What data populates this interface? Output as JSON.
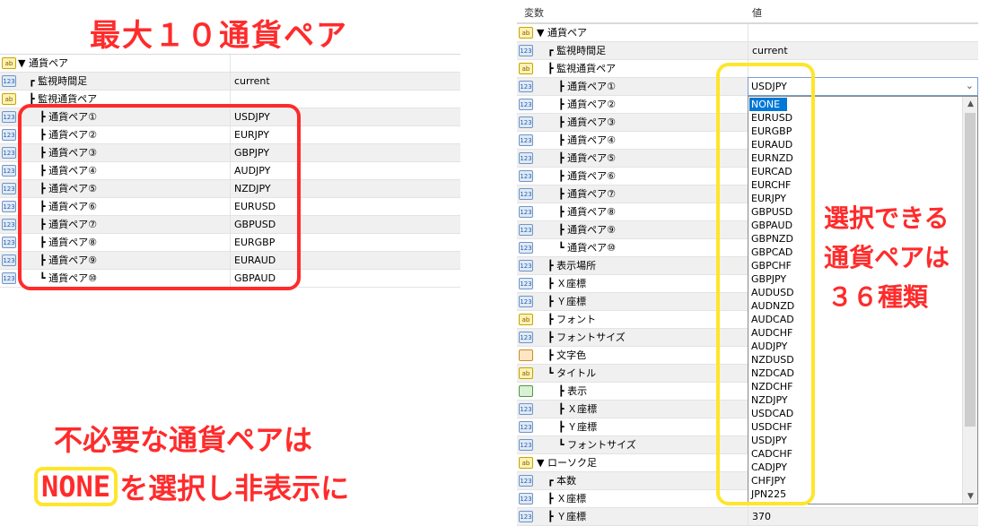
{
  "title": "最大１０通貨ペア",
  "note_unneeded_line1": "不必要な通貨ペアは",
  "note_none": "NONE",
  "note_unneeded_line2": "を選択し非表示に",
  "note_select_lines": [
    "選択できる",
    "通貨ペアは",
    "３６種類"
  ],
  "icons": {
    "num": "123",
    "ab": "ab"
  },
  "left_grid": {
    "rows": [
      {
        "icon": "ab",
        "name": "▼ 通貨ペア",
        "value": "",
        "indent": 0
      },
      {
        "icon": "num",
        "name": "┏ 監視時間足",
        "value": "current",
        "indent": 1
      },
      {
        "icon": "ab",
        "name": "┣ 監視通貨ペア",
        "value": "",
        "indent": 1
      },
      {
        "icon": "num",
        "name": "┣ 通貨ペア①",
        "value": "USDJPY",
        "indent": 2
      },
      {
        "icon": "num",
        "name": "┣ 通貨ペア②",
        "value": "EURJPY",
        "indent": 2
      },
      {
        "icon": "num",
        "name": "┣ 通貨ペア③",
        "value": "GBPJPY",
        "indent": 2
      },
      {
        "icon": "num",
        "name": "┣ 通貨ペア④",
        "value": "AUDJPY",
        "indent": 2
      },
      {
        "icon": "num",
        "name": "┣ 通貨ペア⑤",
        "value": "NZDJPY",
        "indent": 2
      },
      {
        "icon": "num",
        "name": "┣ 通貨ペア⑥",
        "value": "EURUSD",
        "indent": 2
      },
      {
        "icon": "num",
        "name": "┣ 通貨ペア⑦",
        "value": "GBPUSD",
        "indent": 2
      },
      {
        "icon": "num",
        "name": "┣ 通貨ペア⑧",
        "value": "EURGBP",
        "indent": 2
      },
      {
        "icon": "num",
        "name": "┣ 通貨ペア⑨",
        "value": "EURAUD",
        "indent": 2
      },
      {
        "icon": "num",
        "name": "┗ 通貨ペア⑩",
        "value": "GBPAUD",
        "indent": 2
      }
    ]
  },
  "right_grid": {
    "header_var": "変数",
    "header_val": "値",
    "rows": [
      {
        "icon": "ab",
        "name": "▼ 通貨ペア",
        "value": "",
        "indent": 0
      },
      {
        "icon": "num",
        "name": "┏ 監視時間足",
        "value": "current",
        "indent": 1
      },
      {
        "icon": "ab",
        "name": "┣ 監視通貨ペア",
        "value": "",
        "indent": 1
      },
      {
        "icon": "num",
        "name": "┣ 通貨ペア①",
        "value": "",
        "indent": 2
      },
      {
        "icon": "num",
        "name": "┣ 通貨ペア②",
        "value": "",
        "indent": 2
      },
      {
        "icon": "num",
        "name": "┣ 通貨ペア③",
        "value": "",
        "indent": 2
      },
      {
        "icon": "num",
        "name": "┣ 通貨ペア④",
        "value": "",
        "indent": 2
      },
      {
        "icon": "num",
        "name": "┣ 通貨ペア⑤",
        "value": "",
        "indent": 2
      },
      {
        "icon": "num",
        "name": "┣ 通貨ペア⑥",
        "value": "",
        "indent": 2
      },
      {
        "icon": "num",
        "name": "┣ 通貨ペア⑦",
        "value": "",
        "indent": 2
      },
      {
        "icon": "num",
        "name": "┣ 通貨ペア⑧",
        "value": "",
        "indent": 2
      },
      {
        "icon": "num",
        "name": "┣ 通貨ペア⑨",
        "value": "",
        "indent": 2
      },
      {
        "icon": "num",
        "name": "┗ 通貨ペア⑩",
        "value": "",
        "indent": 2
      },
      {
        "icon": "num",
        "name": "┣ 表示場所",
        "value": "",
        "indent": 1
      },
      {
        "icon": "num",
        "name": "┣ Ｘ座標",
        "value": "",
        "indent": 1
      },
      {
        "icon": "num",
        "name": "┣ Ｙ座標",
        "value": "",
        "indent": 1
      },
      {
        "icon": "ab",
        "name": "┣ フォント",
        "value": "",
        "indent": 1
      },
      {
        "icon": "num",
        "name": "┣ フォントサイズ",
        "value": "",
        "indent": 1
      },
      {
        "icon": "color",
        "name": "┣ 文字色",
        "value": "",
        "indent": 1
      },
      {
        "icon": "ab",
        "name": "┗ タイトル",
        "value": "",
        "indent": 1
      },
      {
        "icon": "bool",
        "name": "┣ 表示",
        "value": "",
        "indent": 2
      },
      {
        "icon": "num",
        "name": "┣ Ｘ座標",
        "value": "",
        "indent": 2
      },
      {
        "icon": "num",
        "name": "┣ Ｙ座標",
        "value": "",
        "indent": 2
      },
      {
        "icon": "num",
        "name": "┗ フォントサイズ",
        "value": "",
        "indent": 2
      },
      {
        "icon": "ab",
        "name": "▼ ローソク足",
        "value": "",
        "indent": 0
      },
      {
        "icon": "num",
        "name": "┏ 本数",
        "value": "",
        "indent": 1
      },
      {
        "icon": "num",
        "name": "┣ Ｘ座標",
        "value": "",
        "indent": 1
      },
      {
        "icon": "num",
        "name": "┣ Ｙ座標",
        "value": "370",
        "indent": 1
      }
    ]
  },
  "combo": {
    "value": "USDJPY"
  },
  "options": [
    "NONE",
    "EURUSD",
    "EURGBP",
    "EURAUD",
    "EURNZD",
    "EURCAD",
    "EURCHF",
    "EURJPY",
    "GBPUSD",
    "GBPAUD",
    "GBPNZD",
    "GBPCAD",
    "GBPCHF",
    "GBPJPY",
    "AUDUSD",
    "AUDNZD",
    "AUDCAD",
    "AUDCHF",
    "AUDJPY",
    "NZDUSD",
    "NZDCAD",
    "NZDCHF",
    "NZDJPY",
    "USDCAD",
    "USDCHF",
    "USDJPY",
    "CADCHF",
    "CADJPY",
    "CHFJPY",
    "JPN225"
  ],
  "selected_option": "NONE"
}
